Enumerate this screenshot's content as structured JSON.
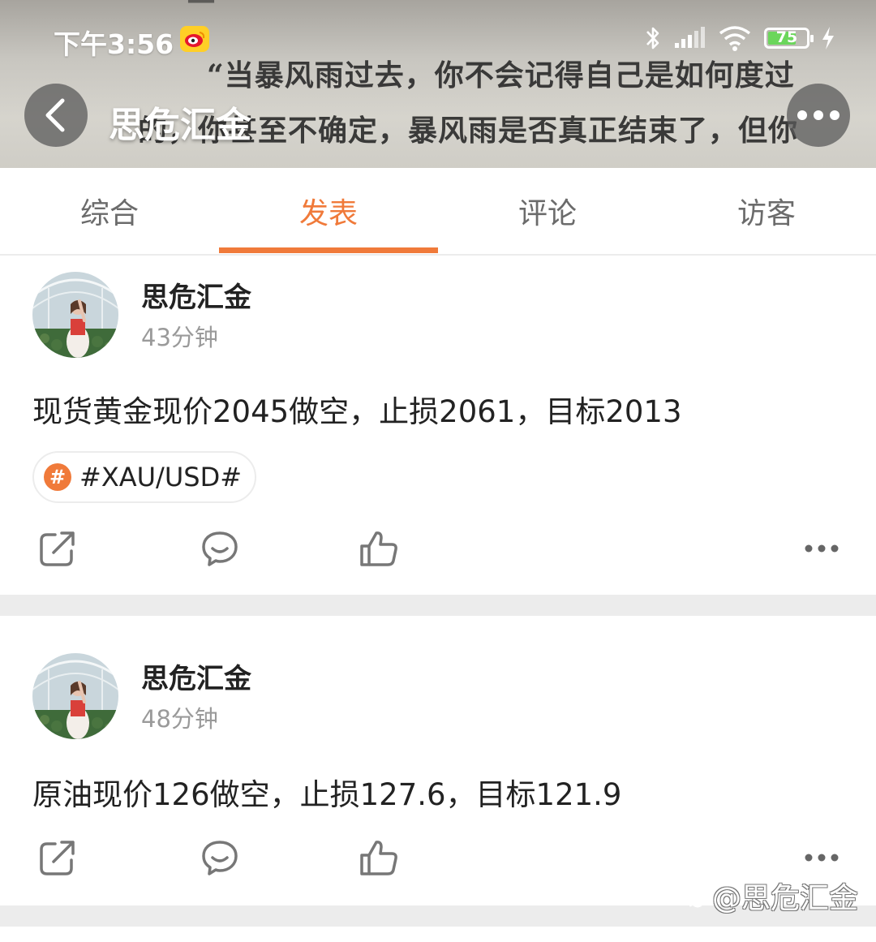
{
  "status_bar": {
    "time": "下午3:56",
    "battery": "75",
    "battery_level": 0.75
  },
  "header": {
    "title": "思危汇金",
    "background_text": [
      "—",
      "“当暴风雨过去，你不会记得自己是如何度过",
      "的，你甚至不确定，暴风雨是否真正结束了，但你",
      "—"
    ]
  },
  "tabs": [
    {
      "label": "综合",
      "active": false
    },
    {
      "label": "发表",
      "active": true
    },
    {
      "label": "评论",
      "active": false
    },
    {
      "label": "访客",
      "active": false
    }
  ],
  "posts": [
    {
      "author": "思危汇金",
      "time": "43分钟",
      "content": "现货黄金现价2045做空，止损2061，目标2013",
      "topic": "#XAU/USD#"
    },
    {
      "author": "思危汇金",
      "time": "48分钟",
      "content": "原油现价126做空，止损127.6，目标121.9"
    }
  ],
  "watermark": "@思危汇金",
  "colors": {
    "accent": "#f07a3a",
    "divider": "#ececec",
    "muted": "#9a9a9a"
  }
}
